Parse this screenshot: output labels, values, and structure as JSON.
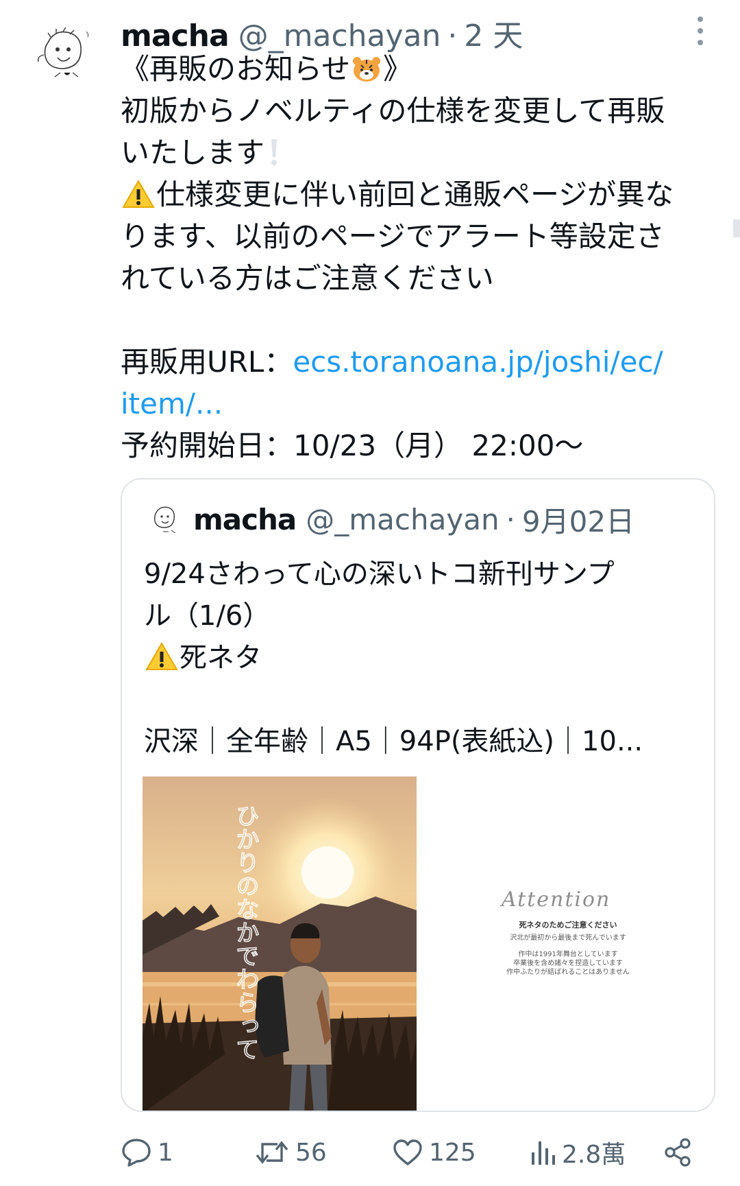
{
  "tweet": {
    "author_name": "macha",
    "handle": "@_machayan",
    "separator": "·",
    "time": "2 天",
    "lines": [
      "《再販のお知らせ",
      "初版からノベルティの仕様を変更して再販",
      "いたします",
      "仕様変更に伴い前回と通販ページが異な",
      "ります、以前のページでアラート等設定さ",
      "れている方はご注意ください"
    ],
    "emoji_tiger_close": "》",
    "url_label": "再販用URL：",
    "url_text_1": "ecs.toranoana.jp/joshi/ec/",
    "url_text_2": "item/...",
    "reserve_line": "予約開始日：10/23（月） 22:00〜"
  },
  "quoted": {
    "author_name": "macha",
    "handle": "@_machayan",
    "separator": "·",
    "time": "9月02日",
    "lines": [
      "9/24さわって心の深いトコ新刊サンプ",
      "ル（1/6）",
      "死ネタ"
    ],
    "details": "沢深｜全年齢｜A5｜94P(表紙込)｜10...",
    "cover_title": "ひかりのなかでわらって",
    "attention": {
      "title": "Attention",
      "line1": "死ネタのためご注意ください",
      "line2": "沢北が最初から最後まで死んでいます",
      "line3": "作中は1991年舞台としています",
      "line4": "卒業後を含め諸々を捏造しています",
      "line5": "作中ふたりが結ばれることはありません"
    }
  },
  "actions": {
    "replies": "1",
    "retweets": "56",
    "likes": "125",
    "views": "2.8萬"
  },
  "colors": {
    "link": "#1d9bf0",
    "muted": "#536471",
    "text": "#0f1419",
    "border": "#dfe3e7"
  },
  "icons": [
    "more-icon",
    "warning-icon",
    "tiger-icon",
    "exclamation-icon",
    "reply-icon",
    "retweet-icon",
    "like-icon",
    "views-icon",
    "share-icon"
  ]
}
